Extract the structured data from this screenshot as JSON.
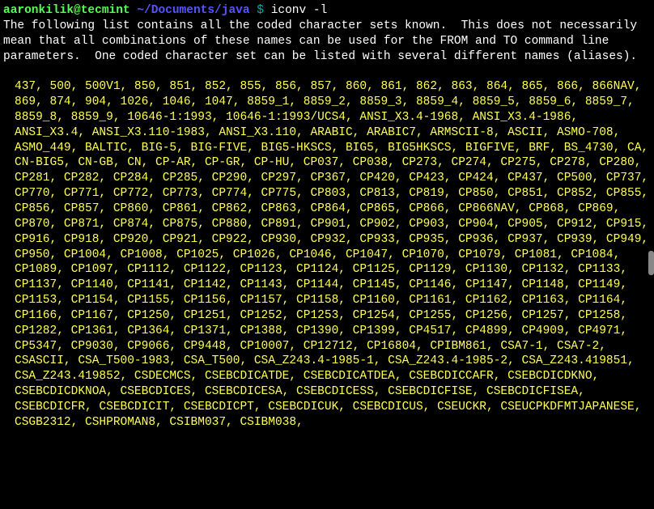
{
  "prompt": {
    "user_host": "aaronkilik@tecmint",
    "separator1": " ",
    "path": "~/Documents/java",
    "dollar": " $ ",
    "command": "iconv -l"
  },
  "description": "The following list contains all the coded character sets known.  This does not necessarily mean that all combinations of these names can be used for the FROM and TO command line parameters.  One coded character set can be listed with several different names (aliases).",
  "listing": "437, 500, 500V1, 850, 851, 852, 855, 856, 857, 860, 861, 862, 863, 864, 865, 866, 866NAV, 869, 874, 904, 1026, 1046, 1047, 8859_1, 8859_2, 8859_3, 8859_4, 8859_5, 8859_6, 8859_7, 8859_8, 8859_9, 10646-1:1993, 10646-1:1993/UCS4, ANSI_X3.4-1968, ANSI_X3.4-1986, ANSI_X3.4, ANSI_X3.110-1983, ANSI_X3.110, ARABIC, ARABIC7, ARMSCII-8, ASCII, ASMO-708, ASMO_449, BALTIC, BIG-5, BIG-FIVE, BIG5-HKSCS, BIG5, BIG5HKSCS, BIGFIVE, BRF, BS_4730, CA, CN-BIG5, CN-GB, CN, CP-AR, CP-GR, CP-HU, CP037, CP038, CP273, CP274, CP275, CP278, CP280, CP281, CP282, CP284, CP285, CP290, CP297, CP367, CP420, CP423, CP424, CP437, CP500, CP737, CP770, CP771, CP772, CP773, CP774, CP775, CP803, CP813, CP819, CP850, CP851, CP852, CP855, CP856, CP857, CP860, CP861, CP862, CP863, CP864, CP865, CP866, CP866NAV, CP868, CP869, CP870, CP871, CP874, CP875, CP880, CP891, CP901, CP902, CP903, CP904, CP905, CP912, CP915, CP916, CP918, CP920, CP921, CP922, CP930, CP932, CP933, CP935, CP936, CP937, CP939, CP949, CP950, CP1004, CP1008, CP1025, CP1026, CP1046, CP1047, CP1070, CP1079, CP1081, CP1084, CP1089, CP1097, CP1112, CP1122, CP1123, CP1124, CP1125, CP1129, CP1130, CP1132, CP1133, CP1137, CP1140, CP1141, CP1142, CP1143, CP1144, CP1145, CP1146, CP1147, CP1148, CP1149, CP1153, CP1154, CP1155, CP1156, CP1157, CP1158, CP1160, CP1161, CP1162, CP1163, CP1164, CP1166, CP1167, CP1250, CP1251, CP1252, CP1253, CP1254, CP1255, CP1256, CP1257, CP1258, CP1282, CP1361, CP1364, CP1371, CP1388, CP1390, CP1399, CP4517, CP4899, CP4909, CP4971, CP5347, CP9030, CP9066, CP9448, CP10007, CP12712, CP16804, CPIBM861, CSA7-1, CSA7-2, CSASCII, CSA_T500-1983, CSA_T500, CSA_Z243.4-1985-1, CSA_Z243.4-1985-2, CSA_Z243.419851, CSA_Z243.419852, CSDECMCS, CSEBCDICATDE, CSEBCDICATDEA, CSEBCDICCAFR, CSEBCDICDKNO, CSEBCDICDKNOA, CSEBCDICES, CSEBCDICESA, CSEBCDICESS, CSEBCDICFISE, CSEBCDICFISEA, CSEBCDICFR, CSEBCDICIT, CSEBCDICPT, CSEBCDICUK, CSEBCDICUS, CSEUCKR, CSEUCPKDFMTJAPANESE, CSGB2312, CSHPROMAN8, CSIBM037, CSIBM038,"
}
